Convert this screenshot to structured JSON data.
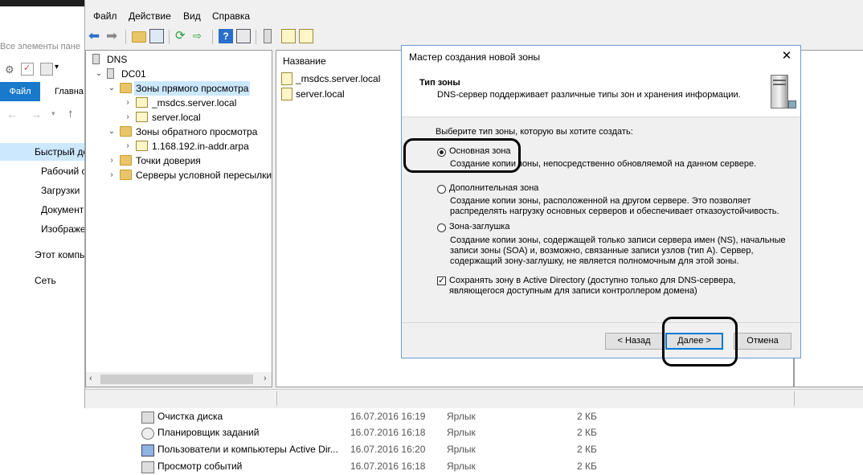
{
  "explorer": {
    "address_text": "Все элементы пане",
    "ribbon": {
      "file_tab": "Файл",
      "main_tab": "Главна"
    },
    "nav": [
      {
        "label": "Быстрый до",
        "icon": "star-icon"
      },
      {
        "label": "Рабочий с",
        "icon": "desktop-icon"
      },
      {
        "label": "Загрузки",
        "icon": "download-icon"
      },
      {
        "label": "Документ",
        "icon": "document-icon"
      },
      {
        "label": "Изображе",
        "icon": "pictures-icon"
      },
      {
        "label": "Этот компь",
        "icon": "computer-icon"
      },
      {
        "label": "Сеть",
        "icon": "network-icon"
      }
    ],
    "rows": [
      {
        "name": "Очистка диска",
        "date": "16.07.2016 16:19",
        "type": "Ярлык",
        "size": "2 КБ"
      },
      {
        "name": "Планировщик заданий",
        "date": "16.07.2016 16:18",
        "type": "Ярлык",
        "size": "2 КБ"
      },
      {
        "name": "Пользователи и компьютеры Active Dir...",
        "date": "16.07.2016 16:20",
        "type": "Ярлык",
        "size": "2 КБ"
      },
      {
        "name": "Просмотр событий",
        "date": "16.07.2016 16:18",
        "type": "Ярлык",
        "size": "2 КБ"
      }
    ]
  },
  "dns": {
    "menu": [
      "Файл",
      "Действие",
      "Вид",
      "Справка"
    ],
    "tree": {
      "root": "DNS",
      "server": "DC01",
      "forward_zones": "Зоны прямого просмотра",
      "zone1": "_msdcs.server.local",
      "zone2": "server.local",
      "reverse_zones": "Зоны обратного просмотра",
      "rzone1": "1.168.192.in-addr.arpa",
      "trust_points": "Точки доверия",
      "conditional": "Серверы условной пересылки"
    },
    "list": {
      "column_name": "Название",
      "items": [
        "_msdcs.server.local",
        "server.local"
      ]
    }
  },
  "wizard": {
    "title": "Мастер создания новой зоны",
    "close": "✕",
    "heading": "Тип зоны",
    "subheading": "DNS-сервер поддерживает различные типы зон и хранения информации.",
    "prompt": "Выберите тип зоны, которую вы хотите создать:",
    "options": [
      {
        "label": "Основная зона",
        "desc": "Создание копии зоны, непосредственно обновляемой на данном сервере.",
        "selected": true
      },
      {
        "label": "Дополнительная зона",
        "desc": "Создание копии зоны, расположенной на другом сервере. Это позволяет распределять нагрузку основных серверов и обеспечивает отказоустойчивость.",
        "selected": false
      },
      {
        "label": "Зона-заглушка",
        "desc": "Создание копии зоны, содержащей только записи сервера имен (NS), начальные записи зоны (SOA) и, возможно, связанные записи узлов (тип A). Сервер, содержащий зону-заглушку, не является полномочным для этой зоны.",
        "selected": false
      }
    ],
    "store_ad": {
      "checked": true,
      "label": "Сохранять зону в Active Directory (доступно только для DNS-сервера, являющегося доступным для записи контроллером домена)"
    },
    "buttons": {
      "back": "< Назад",
      "next": "Далее >",
      "cancel": "Отмена"
    }
  }
}
